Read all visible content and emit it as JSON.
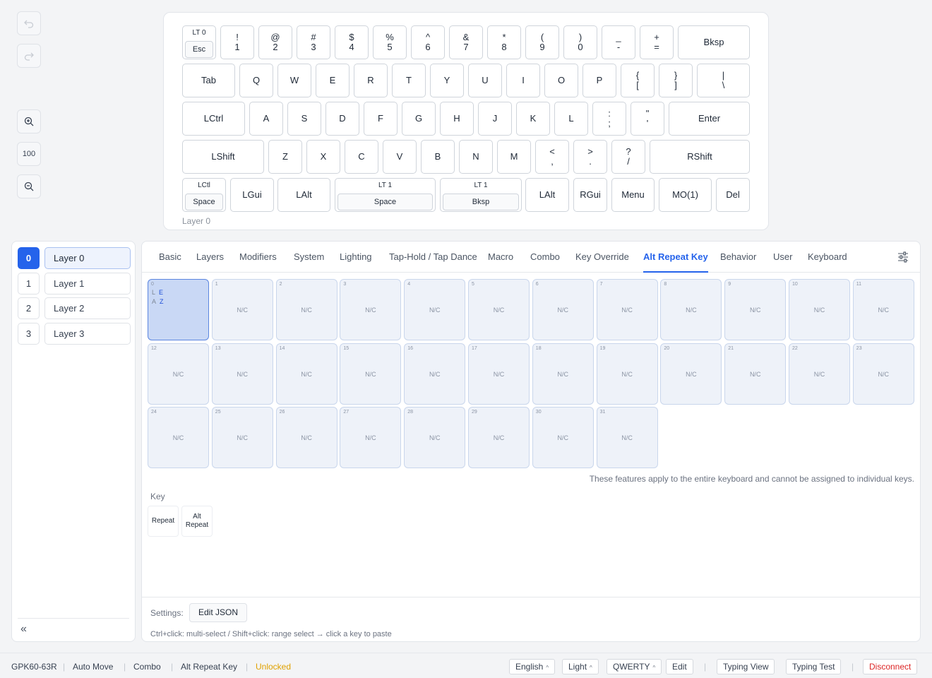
{
  "controls": {
    "zoom_level": "100"
  },
  "keyboard": {
    "layer_caption": "Layer 0",
    "rows": [
      [
        {
          "type": "tap",
          "label": "LT 0",
          "inner": "Esc"
        },
        {
          "top": "!",
          "bot": "1"
        },
        {
          "top": "@",
          "bot": "2"
        },
        {
          "top": "#",
          "bot": "3"
        },
        {
          "top": "$",
          "bot": "4"
        },
        {
          "top": "%",
          "bot": "5"
        },
        {
          "top": "^",
          "bot": "6"
        },
        {
          "top": "&",
          "bot": "7"
        },
        {
          "top": "*",
          "bot": "8"
        },
        {
          "top": "(",
          "bot": "9"
        },
        {
          "top": ")",
          "bot": "0"
        },
        {
          "top": "_",
          "bot": "-"
        },
        {
          "top": "+",
          "bot": "="
        },
        {
          "label": "Bksp"
        }
      ],
      [
        {
          "label": "Tab"
        },
        {
          "label": "Q"
        },
        {
          "label": "W"
        },
        {
          "label": "E"
        },
        {
          "label": "R"
        },
        {
          "label": "T"
        },
        {
          "label": "Y"
        },
        {
          "label": "U"
        },
        {
          "label": "I"
        },
        {
          "label": "O"
        },
        {
          "label": "P"
        },
        {
          "top": "{",
          "bot": "["
        },
        {
          "top": "}",
          "bot": "]"
        },
        {
          "top": "|",
          "bot": "\\"
        }
      ],
      [
        {
          "label": "LCtrl"
        },
        {
          "label": "A"
        },
        {
          "label": "S"
        },
        {
          "label": "D"
        },
        {
          "label": "F"
        },
        {
          "label": "G"
        },
        {
          "label": "H"
        },
        {
          "label": "J"
        },
        {
          "label": "K"
        },
        {
          "label": "L"
        },
        {
          "top": ":",
          "bot": ";"
        },
        {
          "top": "\"",
          "bot": "'"
        },
        {
          "label": "Enter"
        }
      ],
      [
        {
          "label": "LShift"
        },
        {
          "label": "Z"
        },
        {
          "label": "X"
        },
        {
          "label": "C"
        },
        {
          "label": "V"
        },
        {
          "label": "B"
        },
        {
          "label": "N"
        },
        {
          "label": "M"
        },
        {
          "top": "<",
          "bot": ","
        },
        {
          "top": ">",
          "bot": "."
        },
        {
          "top": "?",
          "bot": "/"
        },
        {
          "label": "RShift"
        }
      ],
      [
        {
          "type": "tap",
          "label": "LCtl",
          "inner": "Space"
        },
        {
          "label": "LGui"
        },
        {
          "label": "LAlt"
        },
        {
          "type": "tap",
          "label": "LT 1",
          "inner": "Space"
        },
        {
          "type": "tap",
          "label": "LT 1",
          "inner": "Bksp"
        },
        {
          "label": "LAlt"
        },
        {
          "label": "RGui"
        },
        {
          "label": "Menu"
        },
        {
          "label": "MO(1)"
        },
        {
          "label": "Del"
        }
      ]
    ]
  },
  "layers": [
    {
      "num": "0",
      "name": "Layer 0",
      "active": true
    },
    {
      "num": "1",
      "name": "Layer 1",
      "active": false
    },
    {
      "num": "2",
      "name": "Layer 2",
      "active": false
    },
    {
      "num": "3",
      "name": "Layer 3",
      "active": false
    }
  ],
  "collapse_label": "«",
  "tabs": [
    "Basic",
    "Layers",
    "Modifiers",
    "System",
    "Lighting",
    "Tap-Hold / Tap Dance",
    "Macro",
    "Combo",
    "Key Override",
    "Alt Repeat Key",
    "Behavior",
    "User",
    "Keyboard"
  ],
  "active_tab": "Alt Repeat Key",
  "slots": {
    "count": 32,
    "empty_label": "N/C",
    "first": {
      "index": "0",
      "last_key_prefix": "L",
      "last_key": "E",
      "alt_key_prefix": "A",
      "alt_key": "Z"
    }
  },
  "note": "These features apply to the entire keyboard and cannot be assigned to individual keys.",
  "key_section_label": "Key",
  "key_buttons": [
    "Repeat",
    "Alt\nRepeat"
  ],
  "settings": {
    "label": "Settings:",
    "edit_json": "Edit JSON",
    "hint": "Ctrl+click: multi-select / Shift+click: range select → click a key to paste"
  },
  "status": {
    "device": "GPK60-63R",
    "auto_move": "Auto Move",
    "combo": "Combo",
    "alt_repeat": "Alt Repeat Key",
    "lock": "Unlocked",
    "language": "English",
    "theme": "Light",
    "layout": "QWERTY",
    "edit": "Edit",
    "typing_view": "Typing View",
    "typing_test": "Typing Test",
    "disconnect": "Disconnect"
  },
  "colors": {
    "accent": "#2563eb",
    "warn": "#e0a100",
    "danger": "#dc2626"
  }
}
